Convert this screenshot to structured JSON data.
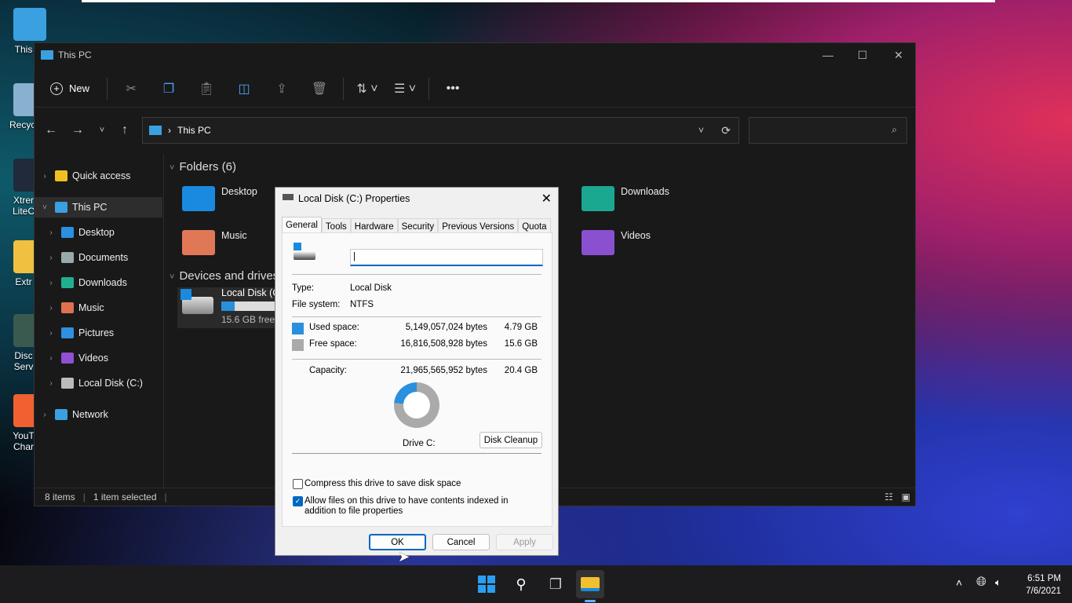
{
  "desktop": {
    "icons": [
      {
        "label": "This",
        "color": "#3aa0e0"
      },
      {
        "label": "Recycl",
        "color": "#8ab0d0"
      },
      {
        "label": "Xtrer LiteC",
        "color": "#202a3a"
      },
      {
        "label": "Extr",
        "color": "#f0c040"
      },
      {
        "label": "Disc Serv",
        "color": "#3a5a50"
      },
      {
        "label": "YouT Char",
        "color": "#f06030"
      }
    ]
  },
  "explorer": {
    "title": "This PC",
    "toolbar": {
      "new_label": "New"
    },
    "address": {
      "path": "This PC"
    },
    "search": {
      "placeholder": ""
    },
    "sidebar": {
      "items": [
        {
          "label": "Quick access",
          "color": "#f0c020"
        },
        {
          "label": "This PC",
          "color": "#3aa0e0"
        },
        {
          "label": "Desktop",
          "color": "#2a90e0"
        },
        {
          "label": "Documents",
          "color": "#9aa"
        },
        {
          "label": "Downloads",
          "color": "#20b090"
        },
        {
          "label": "Music",
          "color": "#e07050"
        },
        {
          "label": "Pictures",
          "color": "#3090e0"
        },
        {
          "label": "Videos",
          "color": "#9050d0"
        },
        {
          "label": "Local Disk (C:)",
          "color": "#bbb"
        },
        {
          "label": "Network",
          "color": "#3aa0e0"
        }
      ]
    },
    "folders_header": "Folders (6)",
    "folders": [
      {
        "label": "Desktop",
        "color": "#1a8ae0"
      },
      {
        "label": "Music",
        "color": "#e07858"
      },
      {
        "label": "Downloads",
        "color": "#1aa890"
      },
      {
        "label": "Videos",
        "color": "#8a50d0"
      }
    ],
    "devices_header": "Devices and drives",
    "drive": {
      "label": "Local Disk (C:)",
      "free": "15.6 GB free of 20.4 GB",
      "used_fraction": 0.234
    },
    "status": {
      "items": "8 items",
      "selected": "1 item selected"
    }
  },
  "dialog": {
    "title": "Local Disk (C:) Properties",
    "tabs": [
      "General",
      "Tools",
      "Hardware",
      "Security",
      "Previous Versions",
      "Quota"
    ],
    "active_tab": "General",
    "name_value": "",
    "type_label": "Type:",
    "type_value": "Local Disk",
    "fs_label": "File system:",
    "fs_value": "NTFS",
    "used": {
      "label": "Used space:",
      "bytes": "5,149,057,024 bytes",
      "size": "4.79 GB",
      "color": "#2a8fdc"
    },
    "free": {
      "label": "Free space:",
      "bytes": "16,816,508,928 bytes",
      "size": "15.6 GB",
      "color": "#aaaaaa"
    },
    "capacity": {
      "label": "Capacity:",
      "bytes": "21,965,565,952 bytes",
      "size": "20.4 GB"
    },
    "drive_label": "Drive C:",
    "disk_cleanup": "Disk Cleanup",
    "compress": {
      "label": "Compress this drive to save disk space",
      "checked": false
    },
    "index": {
      "label": "Allow files on this drive to have contents indexed in addition to file properties",
      "checked": true
    },
    "ok": "OK",
    "cancel": "Cancel",
    "apply": "Apply"
  },
  "taskbar": {
    "time": "6:51 PM",
    "date": "7/6/2021"
  }
}
